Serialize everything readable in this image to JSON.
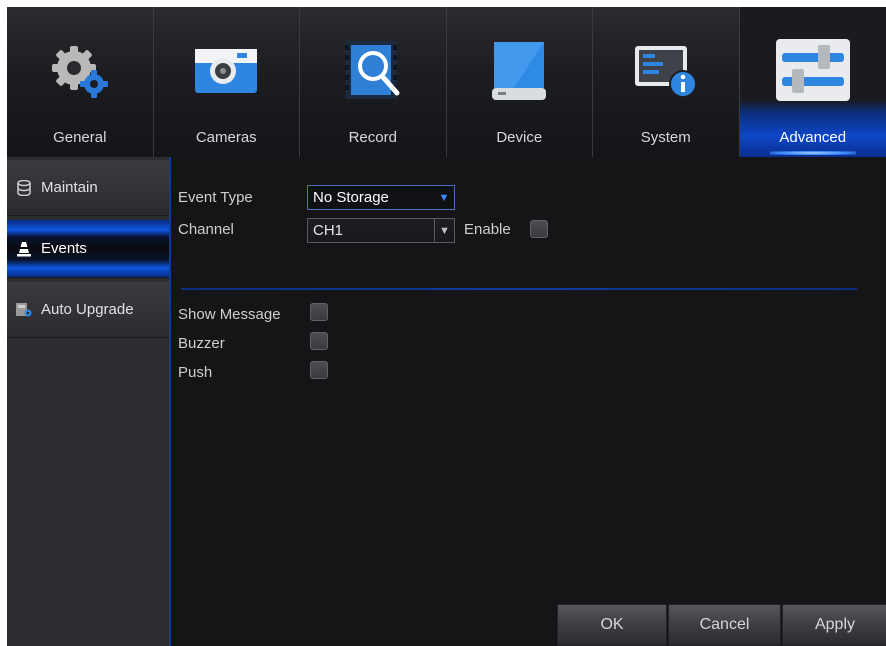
{
  "tabs": [
    {
      "label": "General",
      "icon": "gears-icon"
    },
    {
      "label": "Cameras",
      "icon": "camera-icon"
    },
    {
      "label": "Record",
      "icon": "record-search-icon"
    },
    {
      "label": "Device",
      "icon": "hard-drive-icon"
    },
    {
      "label": "System",
      "icon": "system-info-icon"
    },
    {
      "label": "Advanced",
      "icon": "sliders-icon",
      "active": true
    }
  ],
  "sidebar": {
    "items": [
      {
        "label": "Maintain",
        "icon": "database-icon"
      },
      {
        "label": "Events",
        "icon": "warning-cone-icon",
        "active": true
      },
      {
        "label": "Auto Upgrade",
        "icon": "upgrade-icon"
      }
    ]
  },
  "form": {
    "event_type_label": "Event Type",
    "event_type_value": "No Storage",
    "channel_label": "Channel",
    "channel_value": "CH1",
    "enable_label": "Enable",
    "enable_checked": false,
    "show_message_label": "Show Message",
    "show_message_checked": false,
    "buzzer_label": "Buzzer",
    "buzzer_checked": false,
    "push_label": "Push",
    "push_checked": false
  },
  "buttons": {
    "ok": "OK",
    "cancel": "Cancel",
    "apply": "Apply"
  },
  "colors": {
    "accent": "#0d46c8",
    "background": "#151518",
    "sidebar": "#2c2d31"
  }
}
